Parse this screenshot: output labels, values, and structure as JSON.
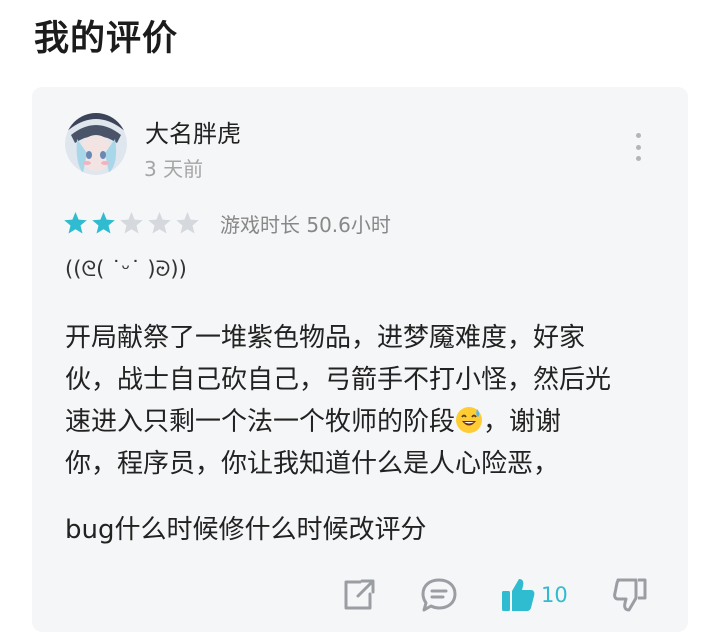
{
  "page": {
    "title": "我的评价"
  },
  "review": {
    "username": "大名胖虎",
    "time": "3 天前",
    "rating": 2,
    "max_rating": 5,
    "playtime": "游戏时长 50.6小时",
    "kaomoji": "((ᘓ( ˙ᵕ˙ )ᘒ))",
    "paragraph1_lines": [
      "开局献祭了一堆紫色物品，进梦魇难度，好家",
      "伙，战士自己砍自己，弓箭手不打小怪，然后光",
      "速进入只剩一个法一个牧师的阶段",
      "你，程序员，你让我知道什么是人心险恶，"
    ],
    "paragraph1_line3_tail": "，谢谢",
    "emoji_name": "sweat-smile-emoji",
    "paragraph2": "bug什么时候修什么时候改评分",
    "like_count": "10"
  },
  "colors": {
    "accent": "#2fbcd0",
    "star_empty": "#d5d8dc",
    "icon_gray": "#9a9ea3",
    "card_bg": "#f5f6f7"
  },
  "icons": [
    "more-vertical-icon",
    "share-icon",
    "comment-icon",
    "thumbs-up-icon",
    "thumbs-down-icon"
  ]
}
